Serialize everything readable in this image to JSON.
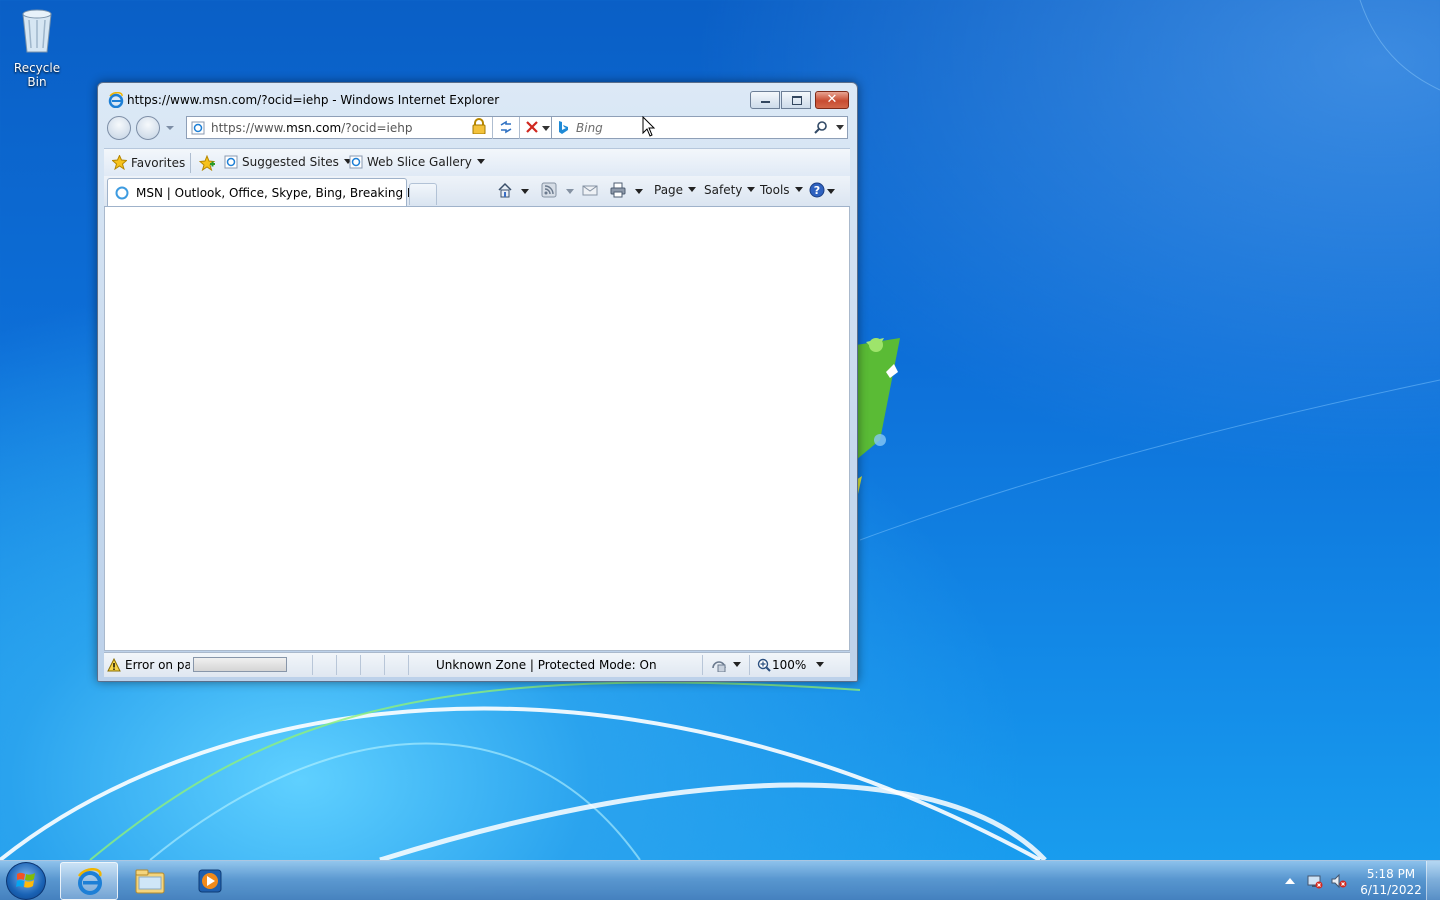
{
  "desktop": {
    "icons": [
      {
        "label": "Recycle Bin",
        "icon": "recycle-bin-icon"
      }
    ]
  },
  "window": {
    "title": "https://www.msn.com/?ocid=iehp - Windows Internet Explorer",
    "address": {
      "prefix": "https://www.",
      "domain": "msn.com",
      "path": "/?ocid=iehp"
    },
    "search": {
      "placeholder": "Bing"
    },
    "favorites_bar": {
      "favorites_label": "Favorites",
      "items": [
        {
          "label": "Suggested Sites"
        },
        {
          "label": "Web Slice Gallery"
        }
      ]
    },
    "tab": {
      "label": "MSN | Outlook, Office, Skype, Bing, Breaking Ne..."
    },
    "command_bar": {
      "page": "Page",
      "safety": "Safety",
      "tools": "Tools"
    },
    "status_bar": {
      "error_text": "Error on pag",
      "zone_text": "Unknown Zone | Protected Mode: On",
      "zoom": "100%"
    }
  },
  "taskbar": {
    "pinned": [
      "internet-explorer-icon",
      "windows-explorer-icon",
      "media-player-icon"
    ],
    "clock": {
      "time": "5:18 PM",
      "date": "6/11/2022"
    }
  }
}
